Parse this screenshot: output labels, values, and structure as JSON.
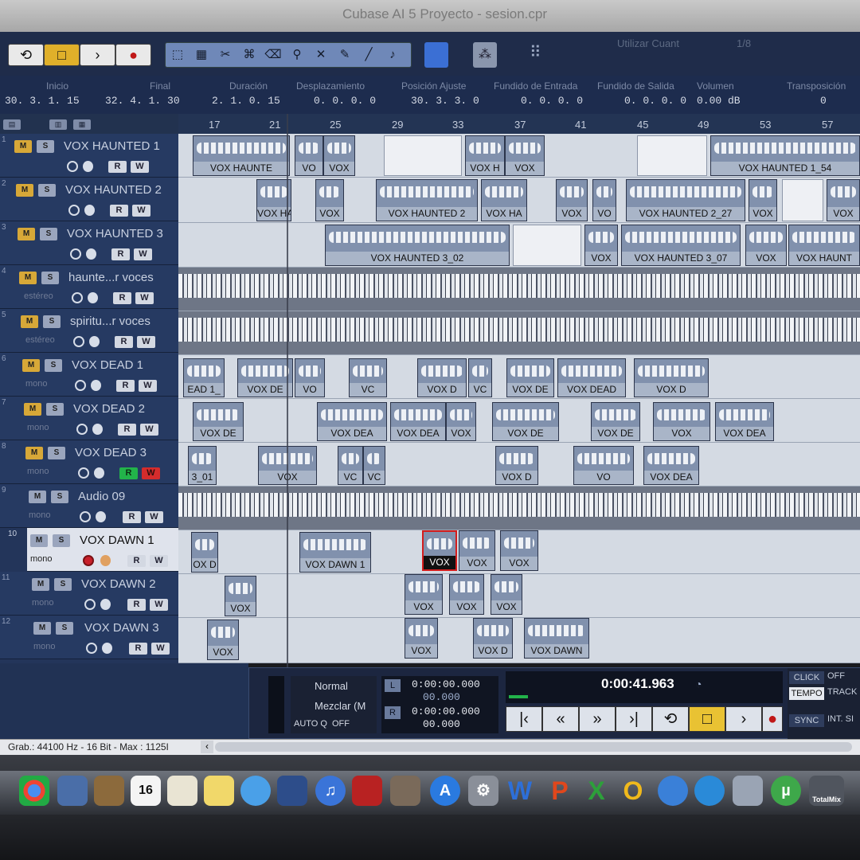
{
  "window": {
    "title": "Cubase AI 5 Proyecto - sesion.cpr"
  },
  "toolbar": {
    "loop_icon": "loop-icon",
    "stop_icon": "stop-icon",
    "play_icon": "play-icon",
    "record_icon": "record-icon",
    "quantize_label": "Utilizar Cuant",
    "ratio_label": "1/8"
  },
  "infoline": {
    "inicio_label": "Inicio",
    "inicio_value": "30. 3. 1. 15",
    "final_label": "Final",
    "final_value": "32. 4. 1. 30",
    "duracion_label": "Duración",
    "duracion_value": "2. 1. 0. 15",
    "desplazamiento_label": "Desplazamiento",
    "desplazamiento_value": "0. 0. 0.   0",
    "posicion_label": "Posición Ajuste",
    "posicion_value": "30. 3. 3.   0",
    "fundido_entrada_label": "Fundido de Entrada",
    "fundido_entrada_value": "0. 0. 0.   0",
    "fundido_salida_label": "Fundido de Salida",
    "fundido_salida_value": "0. 0. 0.   0",
    "volumen_label": "Volumen",
    "volumen_value": "0.00 dB",
    "transposicion_label": "Transposición",
    "transposicion_value": "0"
  },
  "ruler": {
    "marks": [
      "17",
      "21",
      "25",
      "29",
      "33",
      "37",
      "41",
      "45",
      "49",
      "53",
      "57"
    ]
  },
  "tracks": [
    {
      "num": "1",
      "name": "VOX HAUNTED 1",
      "sub": "",
      "m": "M",
      "s": "S",
      "r": "R",
      "w": "W"
    },
    {
      "num": "2",
      "name": "VOX HAUNTED 2",
      "sub": "",
      "m": "M",
      "s": "S",
      "r": "R",
      "w": "W"
    },
    {
      "num": "3",
      "name": "VOX HAUNTED 3",
      "sub": "",
      "m": "M",
      "s": "S",
      "r": "R",
      "w": "W"
    },
    {
      "num": "4",
      "name": "haunte...r voces",
      "sub": "estéreo",
      "m": "M",
      "s": "S",
      "r": "R",
      "w": "W"
    },
    {
      "num": "5",
      "name": "spiritu...r voces",
      "sub": "estéreo",
      "m": "M",
      "s": "S",
      "r": "R",
      "w": "W"
    },
    {
      "num": "6",
      "name": "VOX DEAD 1",
      "sub": "mono",
      "m": "M",
      "s": "S",
      "r": "R",
      "w": "W"
    },
    {
      "num": "7",
      "name": "VOX DEAD 2",
      "sub": "mono",
      "m": "M",
      "s": "S",
      "r": "R",
      "w": "W"
    },
    {
      "num": "8",
      "name": "VOX DEAD 3",
      "sub": "mono",
      "m": "M",
      "s": "S",
      "r": "R",
      "w": "W"
    },
    {
      "num": "9",
      "name": "Audio 09",
      "sub": "mono",
      "m": "M",
      "s": "S",
      "r": "R",
      "w": "W"
    },
    {
      "num": "10",
      "name": "VOX DAWN 1",
      "sub": "mono",
      "m": "M",
      "s": "S",
      "r": "R",
      "w": "W"
    },
    {
      "num": "11",
      "name": "VOX DAWN 2",
      "sub": "mono",
      "m": "M",
      "s": "S",
      "r": "R",
      "w": "W"
    },
    {
      "num": "12",
      "name": "VOX DAWN 3",
      "sub": "mono",
      "m": "M",
      "s": "S",
      "r": "R",
      "w": "W"
    }
  ],
  "events": {
    "t1": [
      "VOX HAUNTE",
      "VO",
      "VOX",
      "VOX H",
      "VOX",
      "VOX HAUNTED 1_54"
    ],
    "t2": [
      "VOX HAI",
      "VOX",
      "VOX HAUNTED 2",
      "VOX HA",
      "VOX",
      "VO",
      "VOX HAUNTED 2_27",
      "VOX",
      "VOX"
    ],
    "t3": [
      "VOX HAUNTED 3_02",
      "VOX",
      "VOX HAUNTED 3_07",
      "VOX",
      "VOX HAUNT"
    ],
    "t6": [
      "EAD 1_",
      "VOX DE",
      "VO",
      "VC",
      "VOX D",
      "VC",
      "VOX DE",
      "VOX DEAD",
      "VOX D"
    ],
    "t7": [
      "VOX DE",
      "VOX DEA",
      "VOX DEA",
      "VOX",
      "VOX DE",
      "VOX DE",
      "VOX",
      "VOX DEA"
    ],
    "t8": [
      "3_01",
      "VOX",
      "VC",
      "VC",
      "VOX D",
      "VO",
      "VOX DEA"
    ],
    "t10": [
      "OX D",
      "VOX DAWN 1",
      "VOX",
      "VOX",
      "VOX"
    ],
    "t11": [
      "VOX",
      "VOX",
      "VOX",
      "VOX"
    ],
    "t12": [
      "VOX",
      "VOX",
      "VOX D",
      "VOX DAWN"
    ]
  },
  "transport": {
    "mode_label": "Normal",
    "mix_label": "Mezclar (M",
    "autoq_label": "AUTO Q",
    "autoq_value": "OFF",
    "left_time": "0:00:00.000",
    "left_tempo": "00.000",
    "right_time": "0:00:00.000",
    "right_tempo": "00.000",
    "l_label": "L",
    "r_label": "R",
    "main_time": "0:00:41.963",
    "click_label": "CLICK",
    "click_value": "OFF",
    "tempo_label": "TEMPO",
    "tempo_value": "TRACK",
    "sync_label": "SYNC",
    "sync_value": "INT. SI"
  },
  "status": {
    "text": "Grab.: 44100 Hz - 16 Bit - Max : 1125I"
  },
  "dock": {
    "items": [
      "chrome-icon",
      "preview-icon",
      "notes-icon",
      "calendar-icon",
      "textedit-icon",
      "stickies-icon",
      "messages-icon",
      "facetime-icon",
      "itunes-icon",
      "photo-icon",
      "image-capture-icon",
      "appstore-icon",
      "system-prefs-icon",
      "word-icon",
      "powerpoint-icon",
      "excel-icon",
      "outlook-icon",
      "messenger-icon",
      "downloads-icon",
      "network-icon",
      "utorrent-icon",
      "totalmix-icon"
    ],
    "calendar_day": "16",
    "word_letter": "W",
    "ppt_letter": "P",
    "excel_letter": "X",
    "outlook_letter": "O",
    "totalmix_label": "TotalMix"
  }
}
